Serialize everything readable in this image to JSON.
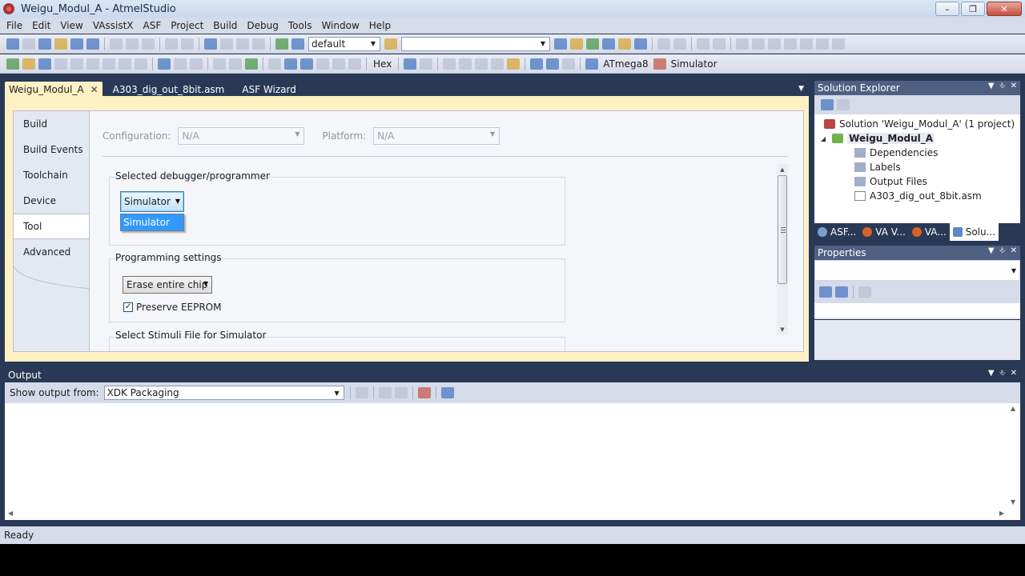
{
  "window": {
    "title": "Weigu_Modul_A - AtmelStudio"
  },
  "menu": [
    "File",
    "Edit",
    "View",
    "VAssistX",
    "ASF",
    "Project",
    "Build",
    "Debug",
    "Tools",
    "Window",
    "Help"
  ],
  "toolbar": {
    "config_combo": "default",
    "search_combo": "",
    "hex_label": "Hex",
    "device_label": "ATmega8",
    "tool_label": "Simulator"
  },
  "tabs": [
    {
      "label": "Weigu_Modul_A",
      "active": true
    },
    {
      "label": "A303_dig_out_8bit.asm",
      "active": false
    },
    {
      "label": "ASF Wizard",
      "active": false
    }
  ],
  "sidebar": [
    "Build",
    "Build Events",
    "Toolchain",
    "Device",
    "Tool",
    "Advanced"
  ],
  "sidebar_active": "Tool",
  "config": {
    "configuration_label": "Configuration:",
    "configuration_value": "N/A",
    "platform_label": "Platform:",
    "platform_value": "N/A"
  },
  "debugger": {
    "group_title": "Selected debugger/programmer",
    "selected": "Simulator",
    "options": [
      "Simulator"
    ]
  },
  "programming": {
    "group_title": "Programming settings",
    "erase_option": "Erase entire chip",
    "preserve_eeprom_label": "Preserve EEPROM",
    "preserve_eeprom_checked": true
  },
  "stimuli": {
    "group_title": "Select Stimuli File for Simulator"
  },
  "solution_explorer": {
    "title": "Solution Explorer",
    "solution": "Solution 'Weigu_Modul_A' (1 project)",
    "project": "Weigu_Modul_A",
    "children": [
      "Dependencies",
      "Labels",
      "Output Files",
      "A303_dig_out_8bit.asm"
    ],
    "tabs": [
      "ASF...",
      "VA V...",
      "VA...",
      "Solu..."
    ]
  },
  "properties": {
    "title": "Properties"
  },
  "output": {
    "title": "Output",
    "show_from_label": "Show output from:",
    "show_from_value": "XDK Packaging"
  },
  "status": {
    "text": "Ready"
  },
  "colors": {
    "background": "#293955",
    "doc_tab_active": "#fff1c4",
    "selection": "#3399ff"
  }
}
